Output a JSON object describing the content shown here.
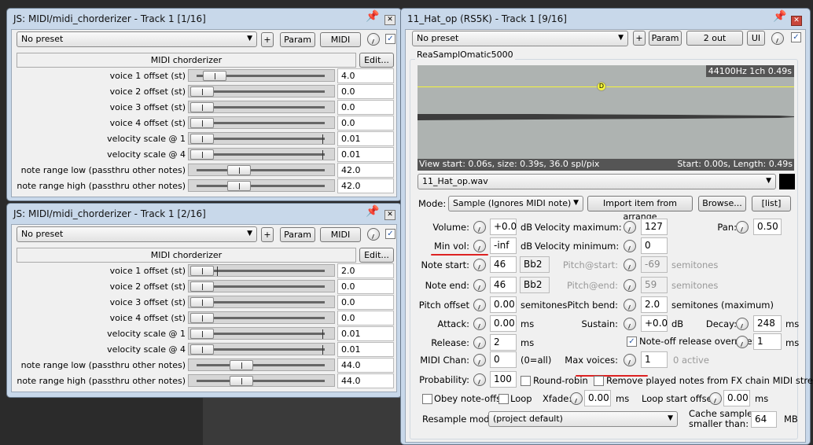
{
  "chorderizer_windows": [
    {
      "title": "JS: MIDI/midi_chorderizer - Track 1 [1/16]",
      "preset": "No preset",
      "plus": "+",
      "param": "Param",
      "midi": "MIDI",
      "plugin_name": "MIDI chorderizer",
      "edit": "Edit...",
      "params": [
        {
          "label": "voice 1 offset (st)",
          "value": "4.0",
          "thumb": 0.1,
          "marker": 0.12
        },
        {
          "label": "voice 2 offset (st)",
          "value": "0.0",
          "thumb": 0.0,
          "marker": 0.0
        },
        {
          "label": "voice 3 offset (st)",
          "value": "0.0",
          "thumb": 0.0,
          "marker": 0.0
        },
        {
          "label": "voice 4 offset (st)",
          "value": "0.0",
          "thumb": 0.0,
          "marker": 0.0
        },
        {
          "label": "velocity scale @ 1",
          "value": "0.01",
          "thumb": 0.0,
          "marker": 0.98
        },
        {
          "label": "velocity scale @ 4",
          "value": "0.01",
          "thumb": 0.0,
          "marker": 0.98
        },
        {
          "label": "note range low (passthru other notes)",
          "value": "42.0",
          "thumb": 0.3,
          "marker": 0.0
        },
        {
          "label": "note range high (passthru other notes)",
          "value": "42.0",
          "thumb": 0.3,
          "marker": 0.0
        }
      ]
    },
    {
      "title": "JS: MIDI/midi_chorderizer - Track 1 [2/16]",
      "preset": "No preset",
      "plus": "+",
      "param": "Param",
      "midi": "MIDI",
      "plugin_name": "MIDI chorderizer",
      "edit": "Edit...",
      "params": [
        {
          "label": "voice 1 offset (st)",
          "value": "2.0",
          "thumb": 0.0,
          "marker": 0.16
        },
        {
          "label": "voice 2 offset (st)",
          "value": "0.0",
          "thumb": 0.0,
          "marker": 0.0
        },
        {
          "label": "voice 3 offset (st)",
          "value": "0.0",
          "thumb": 0.0,
          "marker": 0.0
        },
        {
          "label": "voice 4 offset (st)",
          "value": "0.0",
          "thumb": 0.0,
          "marker": 0.0
        },
        {
          "label": "velocity scale @ 1",
          "value": "0.01",
          "thumb": 0.0,
          "marker": 0.98
        },
        {
          "label": "velocity scale @ 4",
          "value": "0.01",
          "thumb": 0.0,
          "marker": 0.98
        },
        {
          "label": "note range low (passthru other notes)",
          "value": "44.0",
          "thumb": 0.32,
          "marker": 0.0
        },
        {
          "label": "note range high (passthru other notes)",
          "value": "44.0",
          "thumb": 0.32,
          "marker": 0.0
        }
      ]
    }
  ],
  "rs5k": {
    "title": "11_Hat_op (RS5K) - Track 1 [9/16]",
    "preset": "No preset",
    "plus": "+",
    "param": "Param",
    "outs": "2 out",
    "ui": "UI",
    "group": "ReaSamplOmatic5000",
    "wave_info": "44100Hz 1ch 0.49s",
    "wave_marker": "D",
    "view_info": "View start: 0.06s, size: 0.39s, 36.0 spl/pix",
    "length_info": "Start: 0.00s, Length: 0.49s",
    "file": "11_Hat_op.wav",
    "mode_label": "Mode:",
    "mode": "Sample (Ignores MIDI note)",
    "import": "Import item from arrange",
    "browse": "Browse...",
    "list": "[list]",
    "volume": {
      "label": "Volume:",
      "value": "+0.0",
      "unit": "dB"
    },
    "min_vol": {
      "label": "Min vol:",
      "value": "-inf",
      "unit": "dB"
    },
    "note_start": {
      "label": "Note start:",
      "value": "46",
      "note": "Bb2"
    },
    "note_end": {
      "label": "Note end:",
      "value": "46",
      "note": "Bb2"
    },
    "pitch_offset": {
      "label": "Pitch offset",
      "value": "0.00",
      "unit": "semitones"
    },
    "attack": {
      "label": "Attack:",
      "value": "0.00",
      "unit": "ms"
    },
    "release": {
      "label": "Release:",
      "value": "2",
      "unit": "ms"
    },
    "midi_chan": {
      "label": "MIDI Chan:",
      "value": "0",
      "unit": "(0=all)"
    },
    "probability": {
      "label": "Probability:",
      "value": "100"
    },
    "vel_max": {
      "label": "Velocity maximum:",
      "value": "127"
    },
    "vel_min": {
      "label": "Velocity minimum:",
      "value": "0"
    },
    "pitch_start": {
      "label": "Pitch@start:",
      "value": "-69",
      "unit": "semitones"
    },
    "pitch_end": {
      "label": "Pitch@end:",
      "value": "59",
      "unit": "semitones"
    },
    "pitch_bend": {
      "label": "Pitch bend:",
      "value": "2.0",
      "unit": "semitones (maximum)"
    },
    "sustain": {
      "label": "Sustain:",
      "value": "+0.0",
      "unit": "dB"
    },
    "noteoff": {
      "label": "Note-off release override:",
      "value": "1",
      "unit": "ms",
      "checked": true
    },
    "max_voices": {
      "label": "Max voices:",
      "value": "1",
      "status": "0 active"
    },
    "pan": {
      "label": "Pan:",
      "value": "0.50"
    },
    "decay": {
      "label": "Decay:",
      "value": "248",
      "unit": "ms"
    },
    "round_robin": "Round-robin",
    "remove_notes": "Remove played notes from FX chain MIDI stream",
    "obey": "Obey note-offs",
    "loop": "Loop",
    "xfade": {
      "label": "Xfade:",
      "value": "0.00",
      "unit": "ms"
    },
    "loop_offset": {
      "label": "Loop start offset:",
      "value": "0.00",
      "unit": "ms"
    },
    "resample_label": "Resample mode:",
    "resample": "(project default)",
    "cache_label1": "Cache samples",
    "cache_label2": "smaller than:",
    "cache_value": "64",
    "cache_unit": "MB"
  },
  "colors": {
    "waveform_bg": "#aeb3b1",
    "envelope": "#f5f53c",
    "annotation": "#d22222"
  }
}
